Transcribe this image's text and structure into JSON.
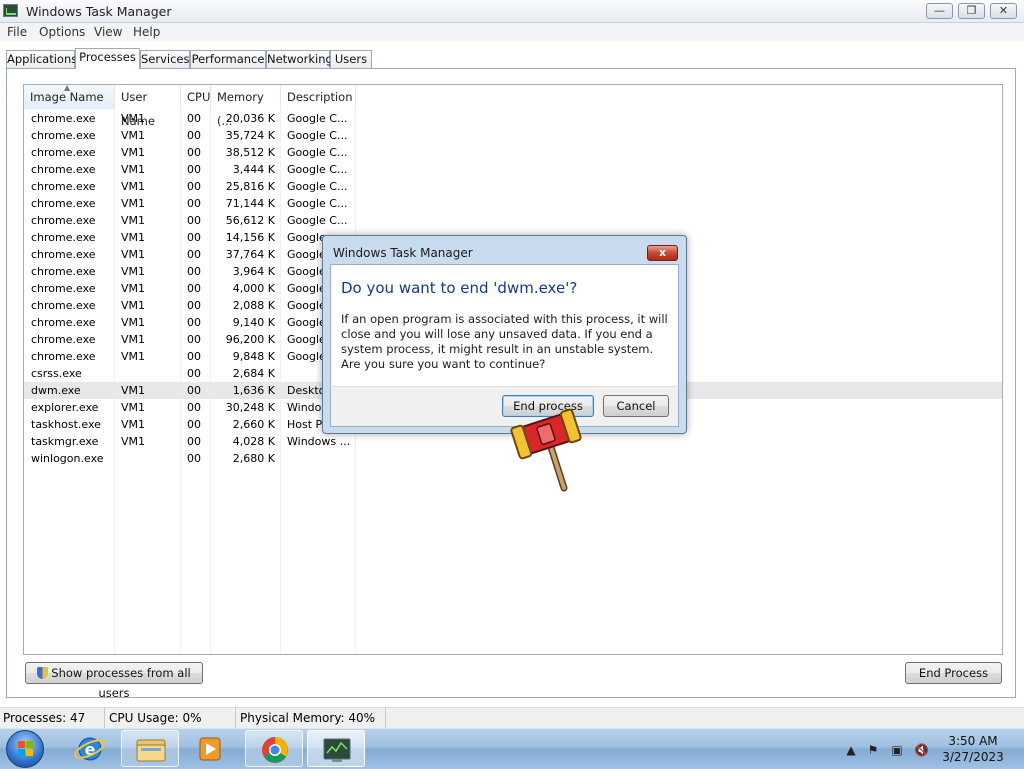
{
  "window": {
    "title": "Windows Task Manager",
    "controls": [
      "minimize",
      "restore",
      "close"
    ]
  },
  "menu": [
    "File",
    "Options",
    "View",
    "Help"
  ],
  "tabs": [
    "Applications",
    "Processes",
    "Services",
    "Performance",
    "Networking",
    "Users"
  ],
  "active_tab": "Processes",
  "table": {
    "columns": [
      "Image Name",
      "User Name",
      "CPU",
      "Memory (...",
      "Description"
    ],
    "sorted_column": "Image Name",
    "selected_row": "dwm.exe",
    "rows": [
      {
        "name": "chrome.exe",
        "user": "VM1",
        "cpu": "00",
        "mem": "20,036 K",
        "desc": "Google C..."
      },
      {
        "name": "chrome.exe",
        "user": "VM1",
        "cpu": "00",
        "mem": "35,724 K",
        "desc": "Google C..."
      },
      {
        "name": "chrome.exe",
        "user": "VM1",
        "cpu": "00",
        "mem": "38,512 K",
        "desc": "Google C..."
      },
      {
        "name": "chrome.exe",
        "user": "VM1",
        "cpu": "00",
        "mem": "3,444 K",
        "desc": "Google C..."
      },
      {
        "name": "chrome.exe",
        "user": "VM1",
        "cpu": "00",
        "mem": "25,816 K",
        "desc": "Google C..."
      },
      {
        "name": "chrome.exe",
        "user": "VM1",
        "cpu": "00",
        "mem": "71,144 K",
        "desc": "Google C..."
      },
      {
        "name": "chrome.exe",
        "user": "VM1",
        "cpu": "00",
        "mem": "56,612 K",
        "desc": "Google C..."
      },
      {
        "name": "chrome.exe",
        "user": "VM1",
        "cpu": "00",
        "mem": "14,156 K",
        "desc": "Google"
      },
      {
        "name": "chrome.exe",
        "user": "VM1",
        "cpu": "00",
        "mem": "37,764 K",
        "desc": "Google"
      },
      {
        "name": "chrome.exe",
        "user": "VM1",
        "cpu": "00",
        "mem": "3,964 K",
        "desc": "Google"
      },
      {
        "name": "chrome.exe",
        "user": "VM1",
        "cpu": "00",
        "mem": "4,000 K",
        "desc": "Google"
      },
      {
        "name": "chrome.exe",
        "user": "VM1",
        "cpu": "00",
        "mem": "2,088 K",
        "desc": "Google"
      },
      {
        "name": "chrome.exe",
        "user": "VM1",
        "cpu": "00",
        "mem": "9,140 K",
        "desc": "Google"
      },
      {
        "name": "chrome.exe",
        "user": "VM1",
        "cpu": "00",
        "mem": "96,200 K",
        "desc": "Google"
      },
      {
        "name": "chrome.exe",
        "user": "VM1",
        "cpu": "00",
        "mem": "9,848 K",
        "desc": "Google"
      },
      {
        "name": "csrss.exe",
        "user": "",
        "cpu": "00",
        "mem": "2,684 K",
        "desc": ""
      },
      {
        "name": "dwm.exe",
        "user": "VM1",
        "cpu": "00",
        "mem": "1,636 K",
        "desc": "Deskto"
      },
      {
        "name": "explorer.exe",
        "user": "VM1",
        "cpu": "00",
        "mem": "30,248 K",
        "desc": "Window"
      },
      {
        "name": "taskhost.exe",
        "user": "VM1",
        "cpu": "00",
        "mem": "2,660 K",
        "desc": "Host Pr"
      },
      {
        "name": "taskmgr.exe",
        "user": "VM1",
        "cpu": "00",
        "mem": "4,028 K",
        "desc": "Windows ..."
      },
      {
        "name": "winlogon.exe",
        "user": "",
        "cpu": "00",
        "mem": "2,680 K",
        "desc": ""
      }
    ]
  },
  "buttons": {
    "show_all": "Show processes from all users",
    "end_process": "End Process"
  },
  "status": {
    "processes": "Processes: 47",
    "cpu": "CPU Usage: 0%",
    "memory": "Physical Memory: 40%"
  },
  "dialog": {
    "title": "Windows Task Manager",
    "close": "x",
    "heading": "Do you want to end 'dwm.exe'?",
    "message": "If an open program is associated with this process, it will close and you will lose any unsaved data. If you end a system process, it might result in an unstable system. Are you sure you want to continue?",
    "confirm": "End process",
    "cancel": "Cancel"
  },
  "taskbar": {
    "items": [
      "internet-explorer",
      "windows-explorer",
      "media-player",
      "google-chrome",
      "task-manager"
    ],
    "tray_icons": [
      "show-hidden-arrow",
      "action-center-flag",
      "network",
      "volume-muted"
    ],
    "time": "3:50 AM",
    "date": "3/27/2023"
  },
  "colors": {
    "dialog_heading": "#15398f",
    "dialog_frame": "#c9dcef",
    "close_red": "#c44a33",
    "taskbar": "#9dbfe0"
  }
}
